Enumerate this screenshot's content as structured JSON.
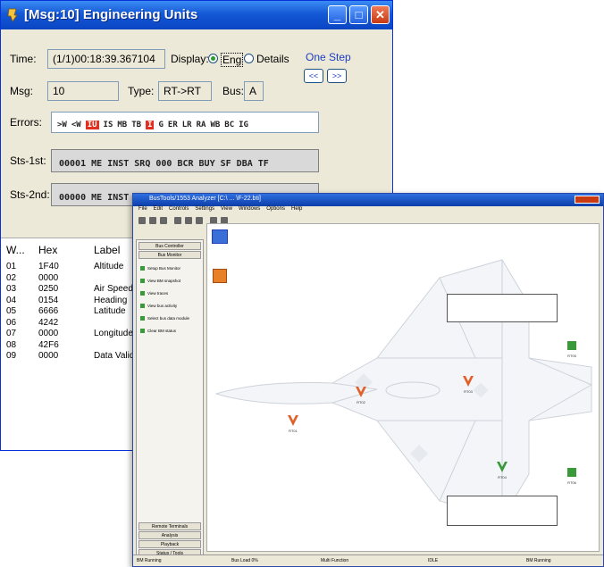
{
  "eu_window": {
    "title": "[Msg:10] Engineering Units",
    "minimize": "_",
    "maximize": "□",
    "close": "✕",
    "time_label": "Time:",
    "time_value": "(1/1)00:18:39.367104",
    "display_label": "Display:",
    "display_eng": "Eng",
    "display_details": "Details",
    "one_step_label": "One Step",
    "step_back": "<<",
    "step_forward": ">>",
    "msg_label": "Msg:",
    "msg_value": "10",
    "type_label": "Type:",
    "type_value": "RT->RT",
    "bus_label": "Bus:",
    "bus_value": "A",
    "errors_label": "Errors:",
    "errors": [
      {
        "t": ">W",
        "on": false
      },
      {
        "t": "<W",
        "on": false
      },
      {
        "t": "IU",
        "on": true
      },
      {
        "t": "IS",
        "on": false
      },
      {
        "t": "MB",
        "on": false
      },
      {
        "t": "TB",
        "on": false
      },
      {
        "t": "I",
        "on": true
      },
      {
        "t": "G",
        "on": false
      },
      {
        "t": "ER",
        "on": false
      },
      {
        "t": "LR",
        "on": false
      },
      {
        "t": "RA",
        "on": false
      },
      {
        "t": "WB",
        "on": false
      },
      {
        "t": "BC",
        "on": false
      },
      {
        "t": "IG",
        "on": false
      }
    ],
    "sts1_label": "Sts-1st:",
    "sts1_value": "00001 ME INST SRQ 000 BCR BUY SF DBA TF",
    "sts2_label": "Sts-2nd:",
    "sts2_value": "00000 ME INST SRQ 000 BCR BUY SF DBA TF",
    "table": {
      "headers": [
        "W...",
        "Hex",
        "Label"
      ],
      "rows": [
        [
          "01",
          "1F40",
          "Altitude"
        ],
        [
          "02",
          "0000",
          ""
        ],
        [
          "03",
          "0250",
          "Air Speed"
        ],
        [
          "04",
          "0154",
          "Heading"
        ],
        [
          "05",
          "6666",
          "Latitude"
        ],
        [
          "06",
          "4242",
          ""
        ],
        [
          "07",
          "0000",
          "Longitude"
        ],
        [
          "08",
          "42F6",
          ""
        ],
        [
          "09",
          "0000",
          "Data Valid"
        ]
      ]
    }
  },
  "bm_window": {
    "title": "BusTools/1553 Analyzer  [C:\\ ... \\F-22.bti]",
    "menu": [
      "File",
      "Edit",
      "Controls",
      "Settings",
      "View",
      "Windows",
      "Options",
      "Help"
    ],
    "side_buttons_top": [
      "Bus Controller",
      "Bus Monitor"
    ],
    "side_items": [
      "Setup Bus Monitor",
      "View BM snapshot",
      "View traces",
      "View bus activity",
      "Select bus data module",
      "Clear BM status"
    ],
    "side_buttons_bottom": [
      "Remote Terminals",
      "Analysis",
      "Playback",
      "Status / Tools"
    ],
    "nodes": [
      "RT01",
      "RT02",
      "RT03",
      "RT04",
      "RT05",
      "RT06",
      "RT07"
    ],
    "status": [
      "BM Running",
      "Bus Load 0%",
      "Multi Function",
      "IDLE",
      "BM Running"
    ]
  }
}
